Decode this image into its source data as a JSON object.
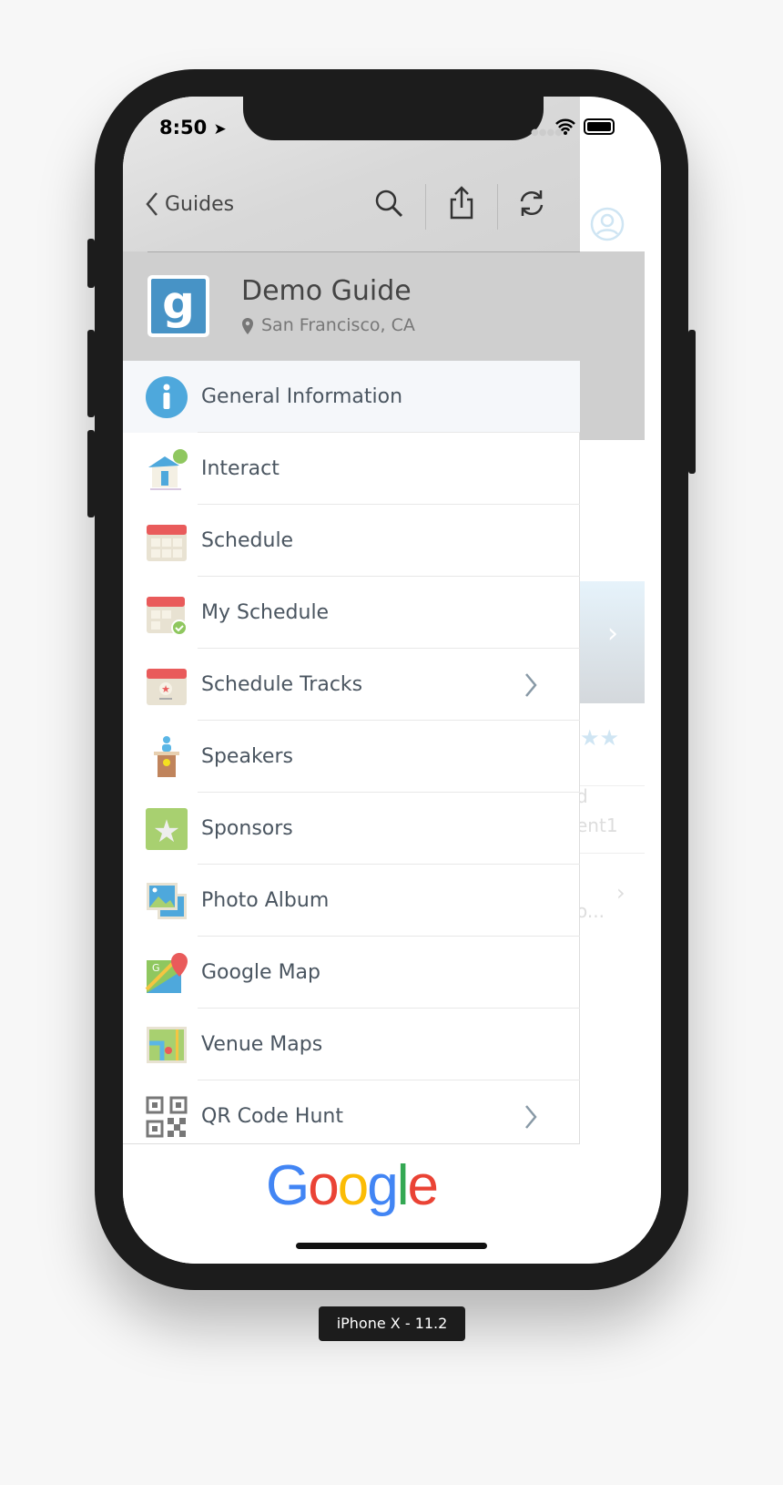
{
  "status": {
    "time": "8:50"
  },
  "nav": {
    "back_label": "Guides"
  },
  "guide": {
    "name": "Demo Guide",
    "location": "San Francisco, CA",
    "logo_letter": "g"
  },
  "menu": [
    {
      "label": "General Information",
      "icon": "info-icon",
      "chevron": false,
      "selected": true
    },
    {
      "label": "Interact",
      "icon": "house-icon",
      "chevron": false
    },
    {
      "label": "Schedule",
      "icon": "calendar-icon",
      "chevron": false
    },
    {
      "label": "My Schedule",
      "icon": "calendar-check-icon",
      "chevron": false
    },
    {
      "label": "Schedule Tracks",
      "icon": "calendar-star-icon",
      "chevron": true
    },
    {
      "label": "Speakers",
      "icon": "podium-icon",
      "chevron": false
    },
    {
      "label": "Sponsors",
      "icon": "star-icon",
      "chevron": false
    },
    {
      "label": "Photo Album",
      "icon": "photo-icon",
      "chevron": false
    },
    {
      "label": "Google Map",
      "icon": "map-pin-icon",
      "chevron": false
    },
    {
      "label": "Venue Maps",
      "icon": "venue-map-icon",
      "chevron": false
    },
    {
      "label": "QR Code Hunt",
      "icon": "qr-code-icon",
      "chevron": true
    }
  ],
  "footer": {
    "logo": "Google"
  },
  "background": {
    "text1": "d",
    "text2": "ent1",
    "text3": "o..."
  },
  "device_label": "iPhone X - 11.2",
  "colors": {
    "accent": "#4a9fd8",
    "text": "#4a5560"
  }
}
